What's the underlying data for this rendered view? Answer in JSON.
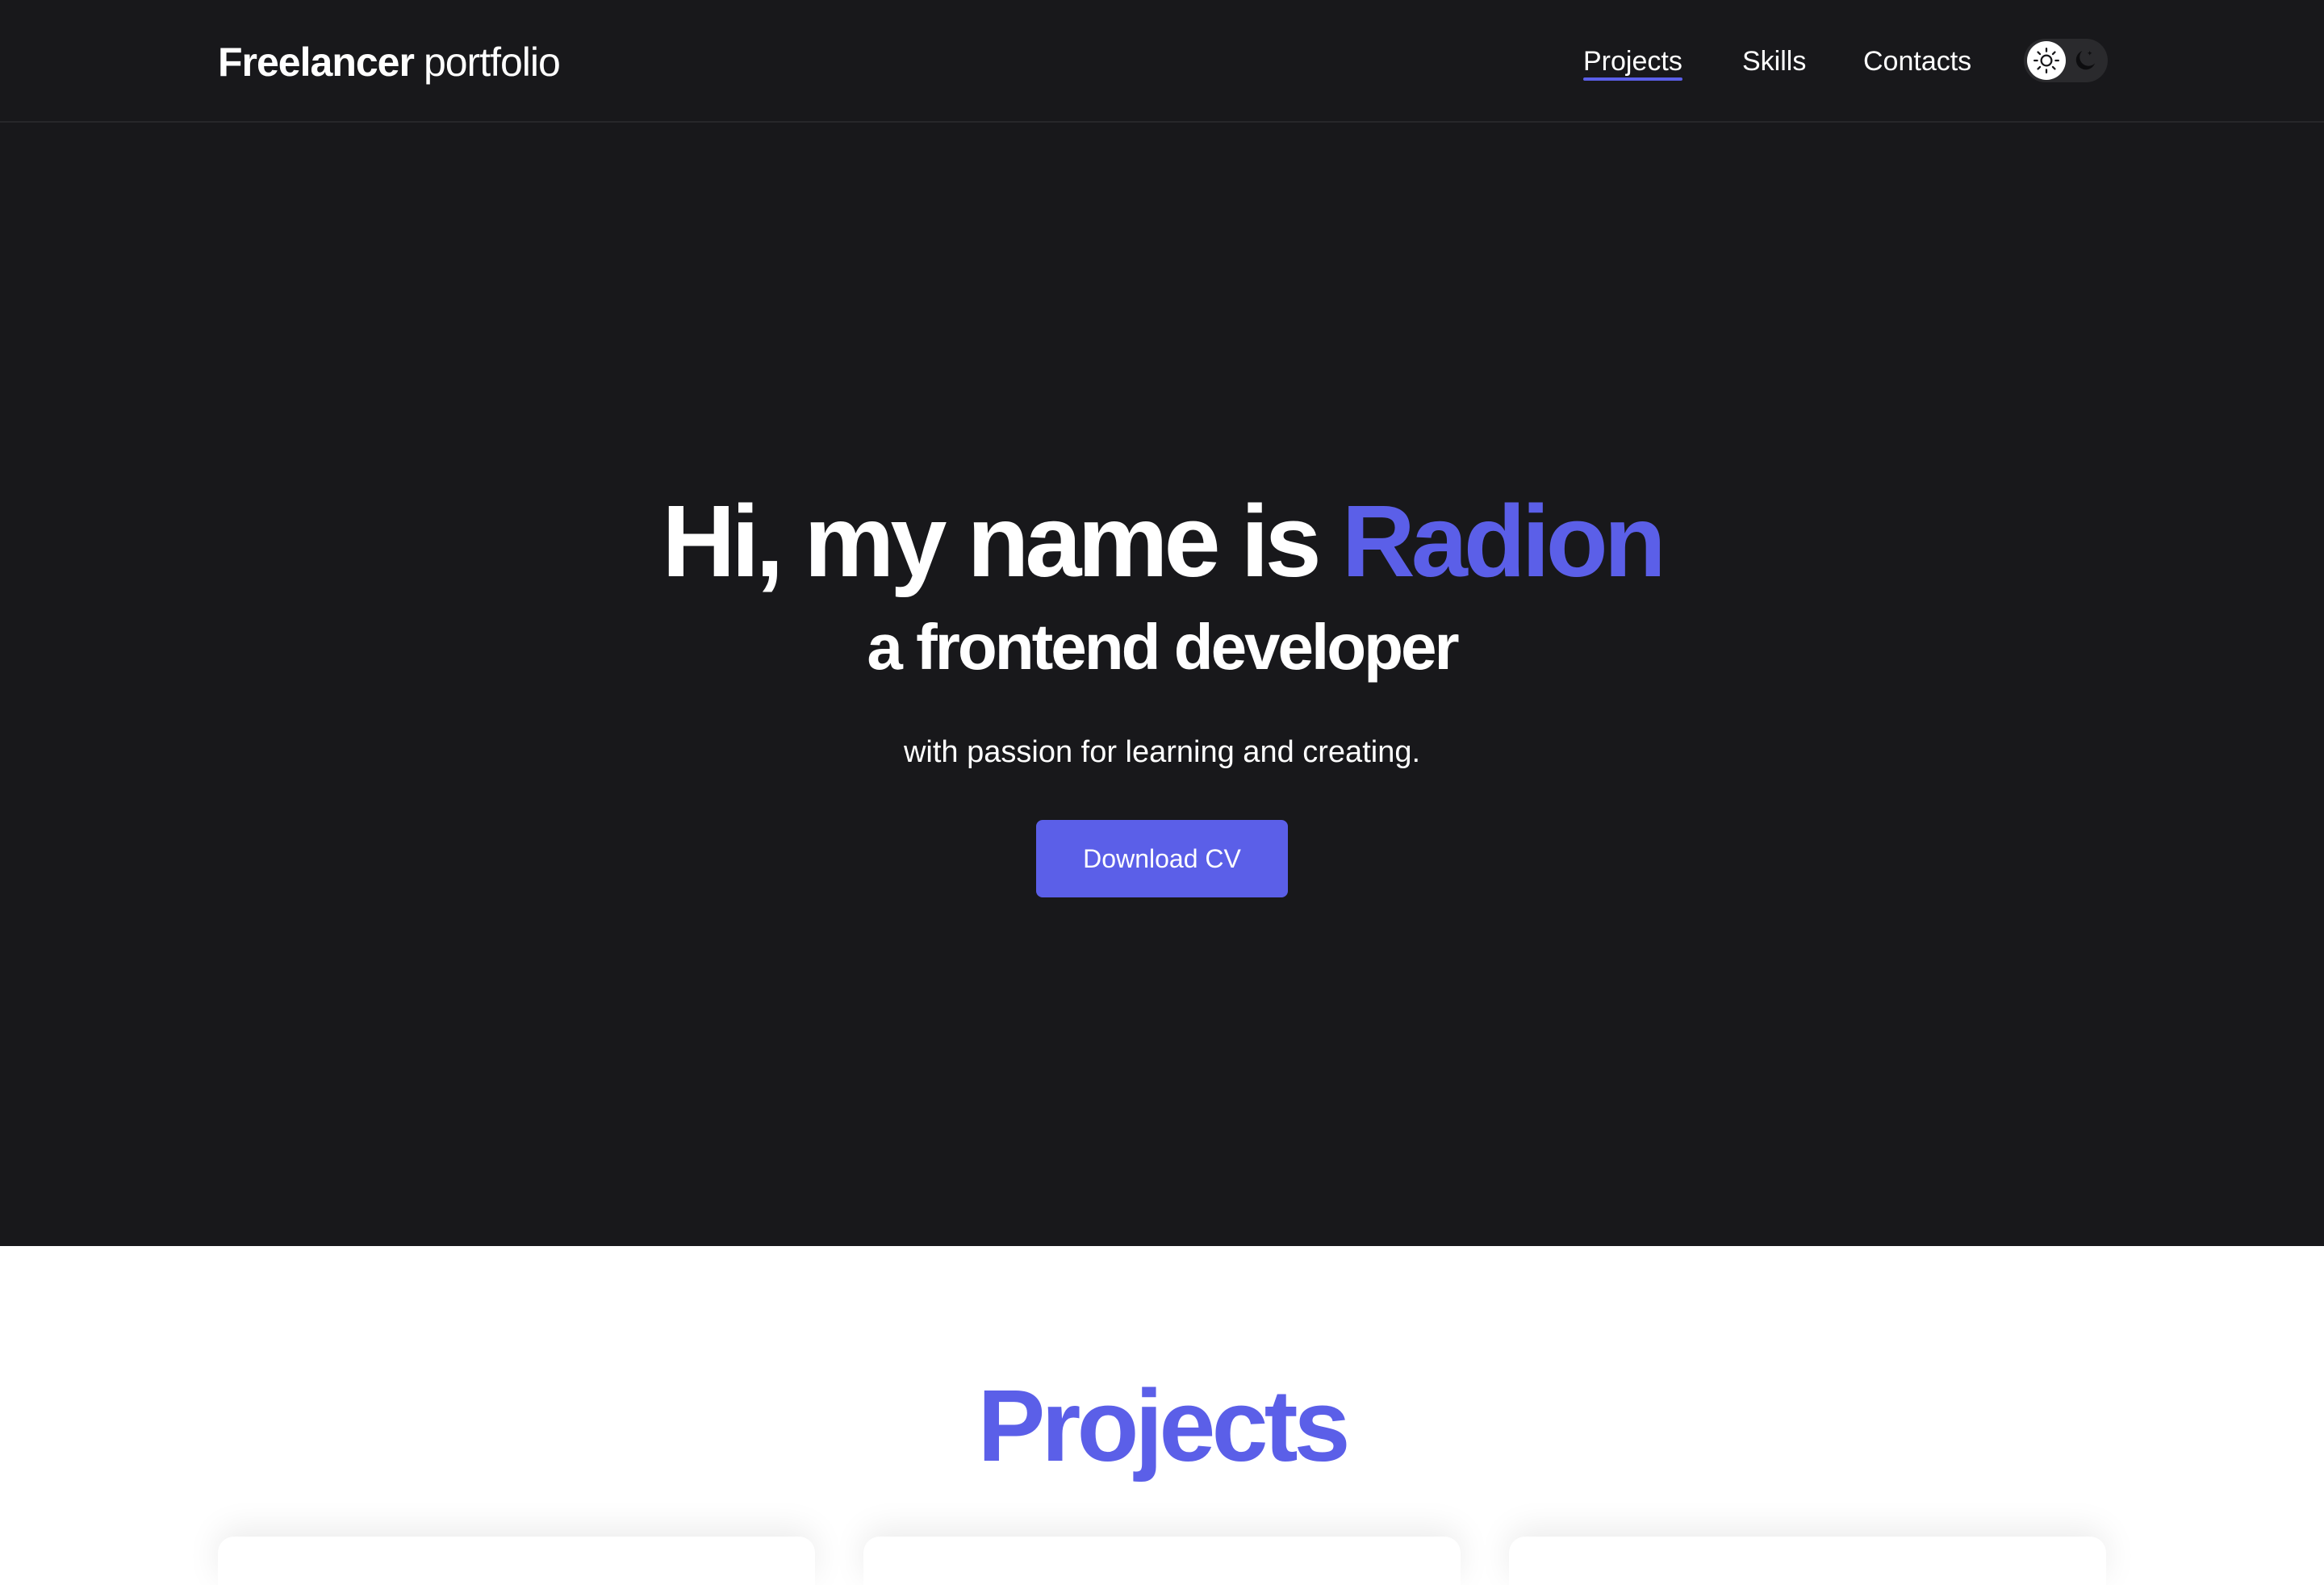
{
  "header": {
    "logo_strong": "Freelancer",
    "logo_light": "portfolio",
    "nav": [
      {
        "label": "Projects",
        "active": true
      },
      {
        "label": "Skills",
        "active": false
      },
      {
        "label": "Contacts",
        "active": false
      }
    ],
    "theme_toggle": {
      "options": [
        "sun-icon",
        "moon-icon"
      ],
      "selected": "sun-icon"
    }
  },
  "hero": {
    "title_prefix": "Hi, my name is ",
    "name": "Radion",
    "role": "a frontend developer",
    "tagline": "with passion for learning and creating.",
    "cta_label": "Download CV"
  },
  "projects": {
    "title": "Projects"
  },
  "colors": {
    "accent": "#5b5fe8",
    "dark_bg": "#18181b",
    "light_bg": "#ffffff",
    "text_on_dark": "#ffffff"
  }
}
